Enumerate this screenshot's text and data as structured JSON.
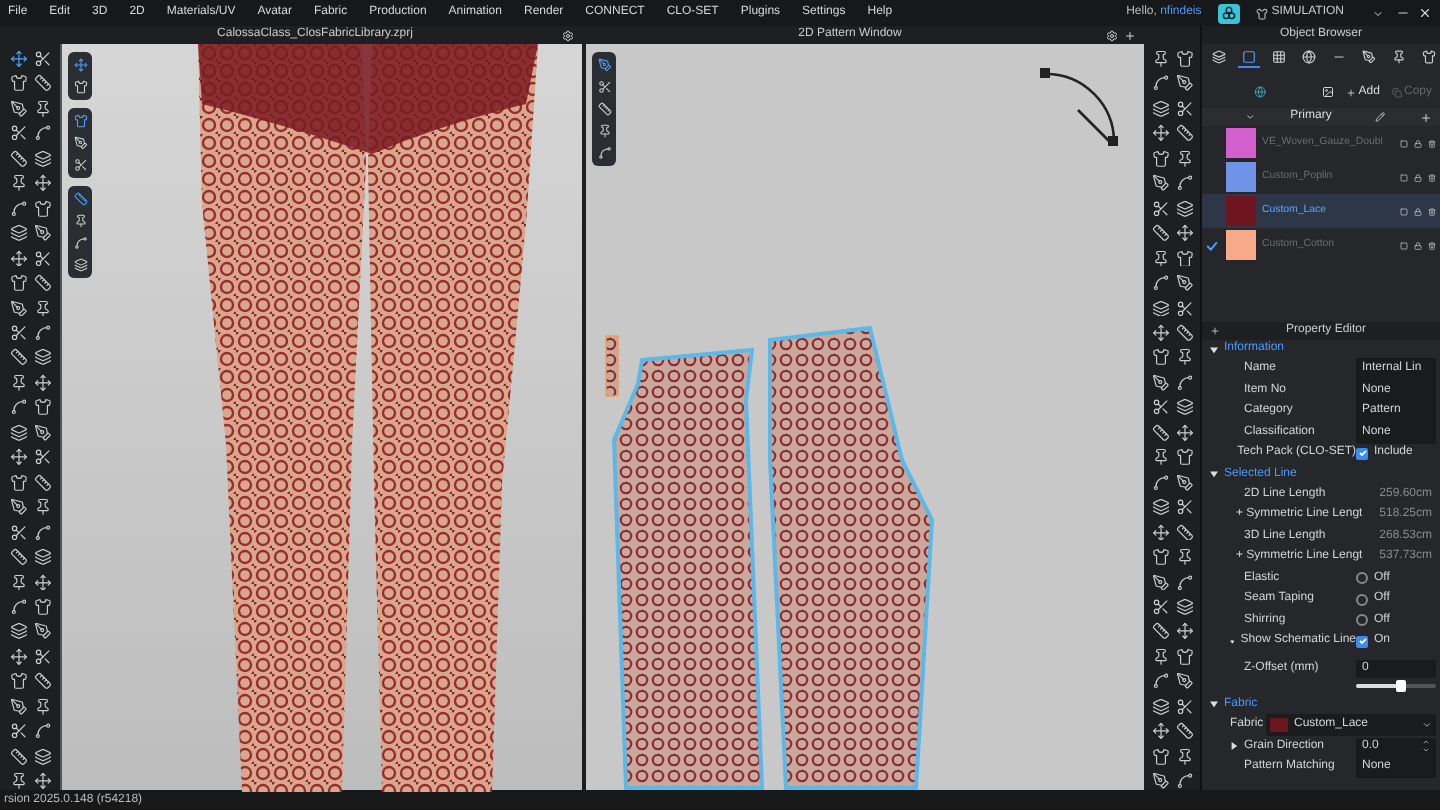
{
  "menu": [
    "File",
    "Edit",
    "3D",
    "2D",
    "Materials/UV",
    "Avatar",
    "Fabric",
    "Production",
    "Animation",
    "Render",
    "CONNECT",
    "CLO-SET",
    "Plugins",
    "Settings",
    "Help"
  ],
  "greeting": {
    "prefix": "Hello,",
    "user": "nfindeis"
  },
  "mode": "SIMULATION",
  "viewport_3d": {
    "title": "CalossaClass_ClosFabricLibrary.zprj"
  },
  "pattern_window": {
    "title": "2D Pattern Window"
  },
  "object_browser": {
    "title": "Object Browser",
    "add": "Add",
    "copy": "Copy",
    "group": "Primary",
    "tabs": [
      {
        "selected": false
      },
      {
        "selected": true
      },
      {
        "selected": false
      },
      {
        "selected": false
      },
      {
        "selected": false
      },
      {
        "selected": false
      },
      {
        "selected": false
      },
      {
        "selected": false
      }
    ],
    "fabrics": [
      {
        "name": "VE_Woven_Gauze_Doubl",
        "color": "#d45fcf",
        "selected": false,
        "checked": false
      },
      {
        "name": "Custom_Poplin",
        "color": "#6f93e6",
        "selected": false,
        "checked": false
      },
      {
        "name": "Custom_Lace",
        "color": "#6e1620",
        "selected": true,
        "checked": false
      },
      {
        "name": "Custom_Cotton",
        "color": "#f7a98a",
        "selected": false,
        "checked": true
      }
    ]
  },
  "property_editor": {
    "title": "Property Editor",
    "sections": [
      {
        "title": "Information",
        "expanded": true,
        "rows": [
          {
            "kind": "field",
            "label": "Name",
            "value": "Internal Lin"
          },
          {
            "kind": "field",
            "label": "Item No",
            "value": "None"
          },
          {
            "kind": "field",
            "label": "Category",
            "value": "Pattern"
          },
          {
            "kind": "field",
            "label": "Classification",
            "value": "None"
          },
          {
            "kind": "check",
            "label": "Tech Pack (CLO-SET)",
            "value": "Include",
            "on": true
          }
        ]
      },
      {
        "title": "Selected Line",
        "expanded": true,
        "rows": [
          {
            "kind": "value",
            "label": "2D Line Length",
            "value": "259.60cm"
          },
          {
            "kind": "value",
            "label": "+ Symmetric Line Lengt",
            "value": "518.25cm"
          },
          {
            "kind": "value",
            "label": "3D Line Length",
            "value": "268.53cm"
          },
          {
            "kind": "value",
            "label": "+ Symmetric Line Lengt",
            "value": "537.73cm"
          },
          {
            "kind": "toggle",
            "label": "Elastic",
            "value": "Off",
            "on": false
          },
          {
            "kind": "toggle",
            "label": "Seam Taping",
            "value": "Off",
            "on": false
          },
          {
            "kind": "toggle",
            "label": "Shirring",
            "value": "Off",
            "on": false
          },
          {
            "kind": "check",
            "label": "Show Schematic Line",
            "value": "On",
            "on": true,
            "expanded": true
          },
          {
            "kind": "slider",
            "label": "Z-Offset (mm)",
            "value": "0",
            "level": 0.55
          }
        ]
      },
      {
        "title": "Fabric",
        "expanded": true,
        "rows": [
          {
            "kind": "fabric",
            "label": "Fabric",
            "value": "Custom_Lace",
            "color": "#6e1620"
          },
          {
            "kind": "stepper",
            "label": "Grain Direction",
            "value": "0.0",
            "expanded": false
          },
          {
            "kind": "field",
            "label": "Pattern Matching",
            "value": "None"
          }
        ]
      }
    ]
  },
  "status_bar": "rsion 2025.0.148 (r54218)"
}
